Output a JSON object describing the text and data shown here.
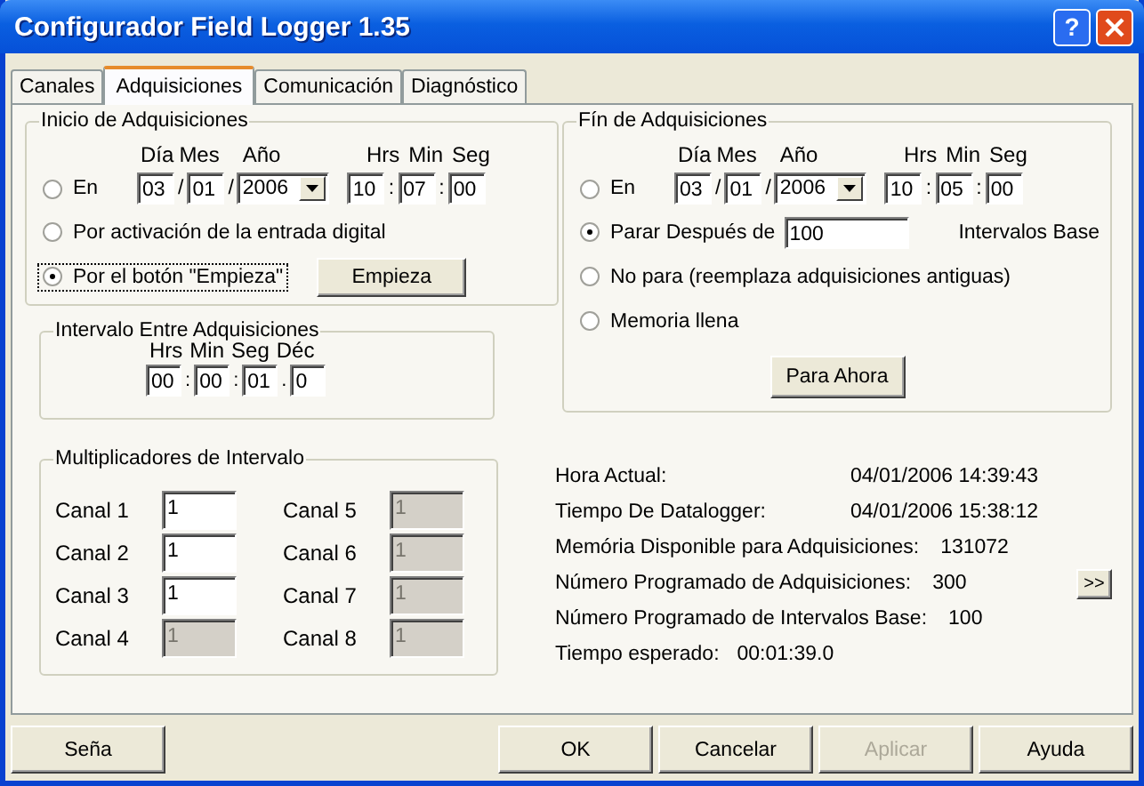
{
  "window": {
    "title": "Configurador Field Logger 1.35",
    "help": "?"
  },
  "tabs": [
    {
      "label": "Canales",
      "selected": false
    },
    {
      "label": "Adquisiciones",
      "selected": true
    },
    {
      "label": "Comunicación",
      "selected": false
    },
    {
      "label": "Diagnóstico",
      "selected": false
    }
  ],
  "start": {
    "title": "Inicio de Adquisiciones",
    "date_headers": [
      "Día",
      "Mes",
      "Año"
    ],
    "time_headers": [
      "Hrs",
      "Min",
      "Seg"
    ],
    "options": [
      {
        "kind": "datetime",
        "label": "En",
        "selected": false,
        "focused": false,
        "date": [
          {
            "value": "03",
            "sep": "/"
          },
          {
            "value": "01",
            "sep": "/"
          },
          {
            "value": "2006",
            "dropdown": true
          }
        ],
        "time": [
          {
            "value": "10",
            "sep": ":"
          },
          {
            "value": "07",
            "sep": ":"
          },
          {
            "value": "00"
          }
        ]
      },
      {
        "kind": "plain",
        "label": "Por activación de la entrada digital",
        "selected": false,
        "focused": false
      },
      {
        "kind": "button",
        "label": "Por el botón \"Empieza\"",
        "selected": true,
        "focused": true,
        "button": "Empieza"
      }
    ]
  },
  "interval": {
    "title": "Intervalo Entre Adquisiciones",
    "headers": [
      "Hrs",
      "Min",
      "Seg",
      "Déc"
    ],
    "fields": [
      {
        "value": "00",
        "sep": ":"
      },
      {
        "value": "00",
        "sep": ":"
      },
      {
        "value": "01",
        "sep": "."
      },
      {
        "value": "0"
      }
    ]
  },
  "multipliers": {
    "title": "Multiplicadores de Intervalo",
    "channels": [
      {
        "label": "Canal 1",
        "value": "1",
        "disabled": false
      },
      {
        "label": "Canal 2",
        "value": "1",
        "disabled": false
      },
      {
        "label": "Canal 3",
        "value": "1",
        "disabled": false
      },
      {
        "label": "Canal 4",
        "value": "1",
        "disabled": true
      },
      {
        "label": "Canal 5",
        "value": "1",
        "disabled": true
      },
      {
        "label": "Canal 6",
        "value": "1",
        "disabled": true
      },
      {
        "label": "Canal 7",
        "value": "1",
        "disabled": true
      },
      {
        "label": "Canal 8",
        "value": "1",
        "disabled": true
      }
    ]
  },
  "end": {
    "title": "Fín de Adquisiciones",
    "date_headers": [
      "Día",
      "Mes",
      "Año"
    ],
    "time_headers": [
      "Hrs",
      "Min",
      "Seg"
    ],
    "options": [
      {
        "kind": "datetime",
        "label": "En",
        "selected": false,
        "focused": false,
        "date": [
          {
            "value": "03",
            "sep": "/"
          },
          {
            "value": "01",
            "sep": "/"
          },
          {
            "value": "2006",
            "dropdown": true
          }
        ],
        "time": [
          {
            "value": "10",
            "sep": ":"
          },
          {
            "value": "05",
            "sep": ":"
          },
          {
            "value": "00"
          }
        ]
      },
      {
        "kind": "count",
        "label": "Parar Después de",
        "selected": true,
        "focused": false,
        "value": "100",
        "suffix": "Intervalos Base"
      },
      {
        "kind": "plain",
        "label": "No para (reemplaza adquisiciones antiguas)",
        "selected": false,
        "focused": false
      },
      {
        "kind": "plain",
        "label": "Memoria llena",
        "selected": false,
        "focused": false
      }
    ],
    "button": "Para Ahora"
  },
  "info": [
    {
      "kind": "timestamp",
      "label": "Hora Actual:",
      "value": "04/01/2006  14:39:43"
    },
    {
      "kind": "timestamp",
      "label": "Tiempo De Datalogger:",
      "value": "04/01/2006  15:38:12"
    },
    {
      "kind": "count",
      "label": "Memória Disponible para Adquisiciones:",
      "value": "131072"
    },
    {
      "kind": "count",
      "label": "Número Programado de Adquisiciones:",
      "value": "300",
      "button": ">>"
    },
    {
      "kind": "count",
      "label": "Número Programado de Intervalos Base:",
      "value": "100"
    },
    {
      "kind": "short",
      "label": "Tiempo esperado:",
      "value": "00:01:39.0"
    }
  ],
  "footer": {
    "left": [
      {
        "label": "Seña",
        "disabled": false
      }
    ],
    "right": [
      {
        "label": "OK",
        "disabled": false
      },
      {
        "label": "Cancelar",
        "disabled": false
      },
      {
        "label": "Aplicar",
        "disabled": true
      },
      {
        "label": "Ayuda",
        "disabled": false
      }
    ]
  }
}
